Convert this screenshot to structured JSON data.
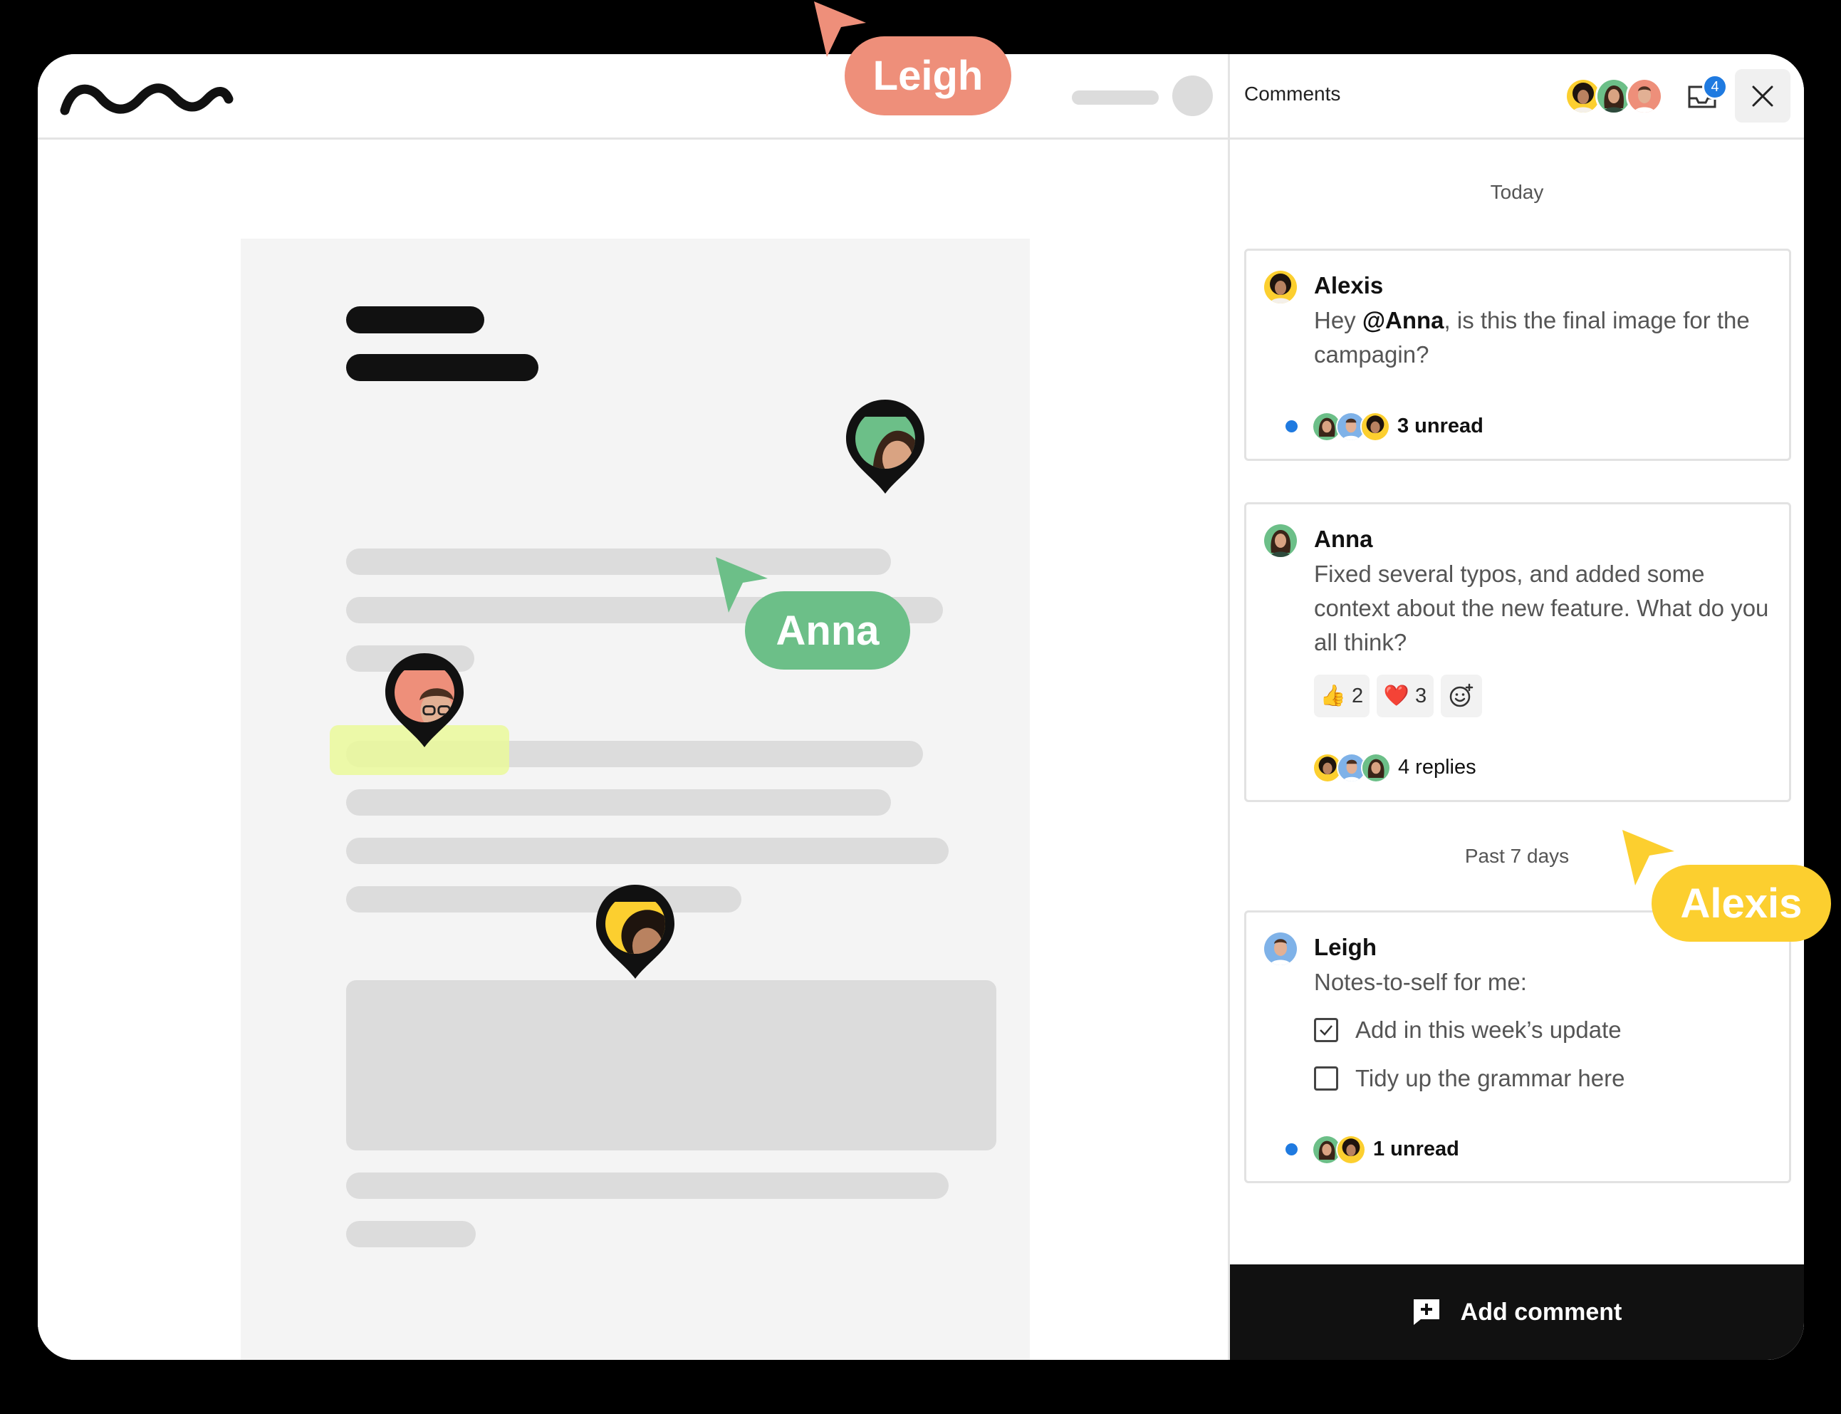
{
  "editor": {
    "collaborators": {
      "leigh": {
        "name": "Leigh",
        "color": "#ee8f7a"
      },
      "anna": {
        "name": "Anna",
        "color": "#6cbf88"
      },
      "alexis": {
        "name": "Alexis",
        "color": "#fccf2f"
      }
    }
  },
  "comments_panel": {
    "title": "Comments",
    "inbox_count": "4",
    "sections": [
      {
        "label": "Today"
      },
      {
        "label": "Past 7 days"
      }
    ],
    "cards": [
      {
        "author": "Alexis",
        "body_prefix": "Hey ",
        "mention": "@Anna",
        "body_suffix": ", is this the final image for the campagin?",
        "thread_text": "3 unread"
      },
      {
        "author": "Anna",
        "body": "Fixed several typos, and added some context about the new feature. What do you all think?",
        "reactions": [
          {
            "emoji": "👍",
            "count": "2"
          },
          {
            "emoji": "❤️",
            "count": "3"
          }
        ],
        "thread_text": "4 replies"
      },
      {
        "author": "Leigh",
        "body": "Notes-to-self for me:",
        "checklist": [
          {
            "label": "Add in this week’s update",
            "checked": true
          },
          {
            "label": "Tidy up the grammar here",
            "checked": false
          }
        ],
        "thread_text": "1 unread"
      }
    ],
    "add_comment_label": "Add comment"
  }
}
